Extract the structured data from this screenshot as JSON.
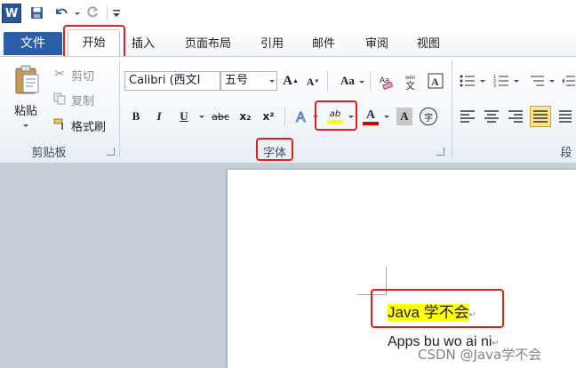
{
  "qat": {
    "app_icon": "word-icon",
    "save_icon": "save-icon",
    "undo_icon": "undo-icon",
    "redo_icon": "redo-icon"
  },
  "tabs": {
    "file": "文件",
    "home": "开始",
    "items": [
      "插入",
      "页面布局",
      "引用",
      "邮件",
      "审阅",
      "视图"
    ]
  },
  "clipboard": {
    "paste": "粘贴",
    "cut": "剪切",
    "copy": "复制",
    "format_painter": "格式刷",
    "group_label": "剪贴板"
  },
  "font": {
    "font_name": "Calibri (西文I",
    "font_size": "五号",
    "grow": "A",
    "shrink": "A",
    "change_case": "Aa",
    "bold": "B",
    "italic": "I",
    "underline": "U",
    "strike": "abc",
    "subscript": "x₂",
    "superscript": "x²",
    "highlight": "ab",
    "font_color": "A",
    "char_shading": "A",
    "enclose": "字",
    "group_label": "字体",
    "highlight_color": "#ffff00",
    "font_color_value": "#e00000"
  },
  "paragraph": {
    "group_label": "段"
  },
  "document": {
    "line1": "Java 学不会",
    "line2": "Apps bu wo ai ni",
    "mark1": "↵",
    "mark2": "↵"
  },
  "watermark": "CSDN @Java学不会"
}
